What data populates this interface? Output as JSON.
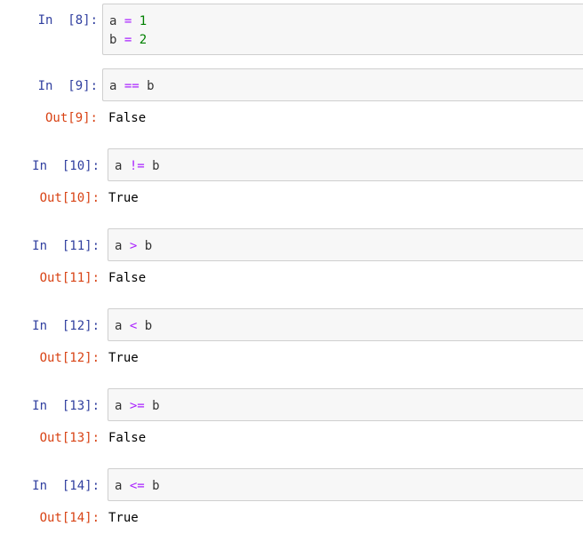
{
  "cells": [
    {
      "in_prompt": "In  [8]:",
      "lines": [
        {
          "a": "a",
          "op": "=",
          "b": "1"
        },
        {
          "a": "b",
          "op": "=",
          "b": "2"
        }
      ]
    },
    {
      "in_prompt": "In  [9]:",
      "code": {
        "a": "a",
        "op": "==",
        "b": "b"
      },
      "out_prompt": "Out[9]:",
      "output": "False"
    },
    {
      "in_prompt": "In  [10]:",
      "code": {
        "a": "a",
        "op": "!=",
        "b": "b"
      },
      "out_prompt": "Out[10]:",
      "output": "True"
    },
    {
      "in_prompt": "In  [11]:",
      "code": {
        "a": "a",
        "op": ">",
        "b": "b"
      },
      "out_prompt": "Out[11]:",
      "output": "False"
    },
    {
      "in_prompt": "In  [12]:",
      "code": {
        "a": "a",
        "op": "<",
        "b": "b"
      },
      "out_prompt": "Out[12]:",
      "output": "True"
    },
    {
      "in_prompt": "In  [13]:",
      "code": {
        "a": "a",
        "op": ">=",
        "b": "b"
      },
      "out_prompt": "Out[13]:",
      "output": "False"
    },
    {
      "in_prompt": "In  [14]:",
      "code": {
        "a": "a",
        "op": "<=",
        "b": "b"
      },
      "out_prompt": "Out[14]:",
      "output": "True"
    }
  ],
  "colors": {
    "in_prompt": "#303F9F",
    "out_prompt": "#D84315",
    "operator": "#AA22FF",
    "number": "#008000",
    "cell_background": "#f7f7f7",
    "cell_border": "#cfcfcf"
  }
}
